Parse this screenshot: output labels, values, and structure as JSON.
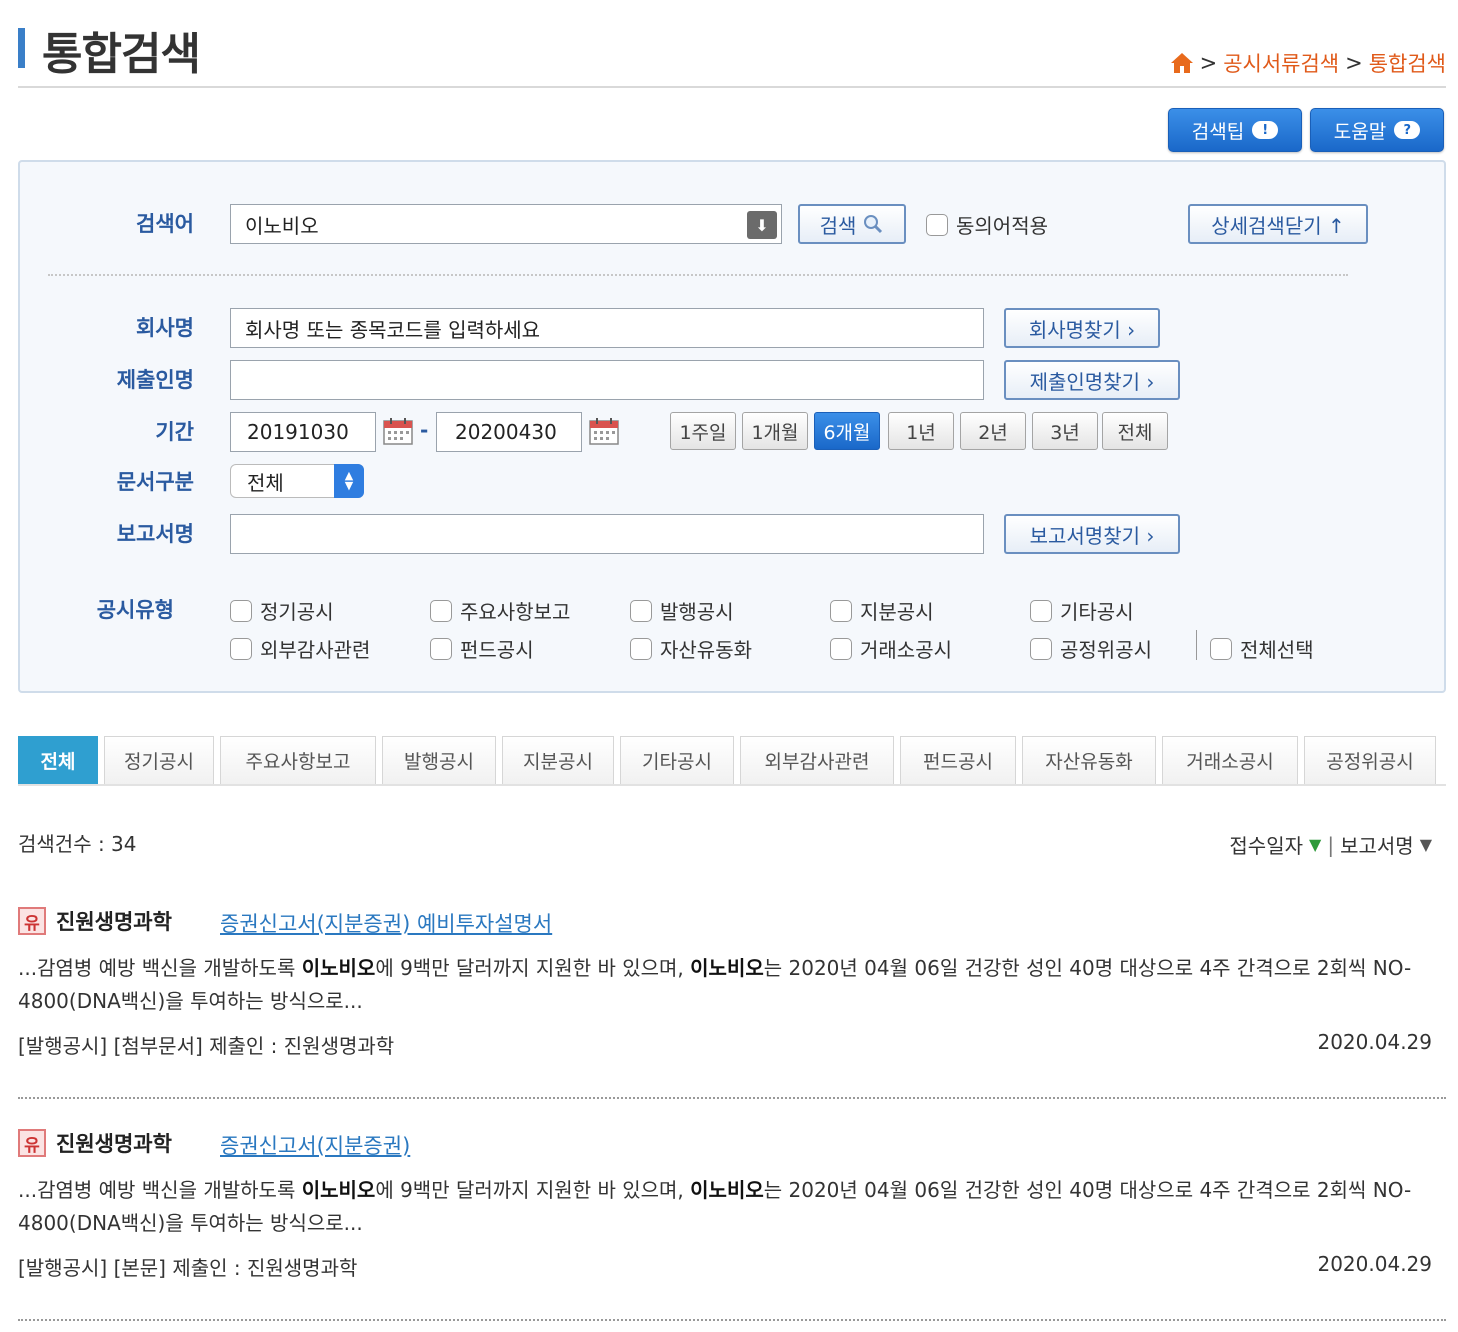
{
  "header": {
    "title": "통합검색",
    "breadcrumb": [
      "공시서류검색",
      "통합검색"
    ],
    "separator": ">"
  },
  "top_buttons": {
    "tips": "검색팁",
    "help": "도움말"
  },
  "search": {
    "keyword_label": "검색어",
    "keyword_value": "이노비오",
    "search_button": "검색",
    "synonym_label": "동의어적용",
    "detail_close_button": "상세검색닫기 ↑",
    "company_label": "회사명",
    "company_placeholder": "회사명 또는 종목코드를 입력하세요",
    "company_find_button": "회사명찾기 ›",
    "submitter_label": "제출인명",
    "submitter_value": "",
    "submitter_find_button": "제출인명찾기 ›",
    "period_label": "기간",
    "start_date": "20191030",
    "date_sep": "-",
    "end_date": "20200430",
    "period_buttons": [
      "1주일",
      "1개월",
      "6개월",
      "1년",
      "2년",
      "3년",
      "전체"
    ],
    "period_active": "6개월",
    "doc_type_label": "문서구분",
    "doc_type_value": "전체",
    "report_label": "보고서명",
    "report_value": "",
    "report_find_button": "보고서명찾기 ›",
    "disclosure_type_label": "공시유형",
    "disclosure_types_row1": [
      "정기공시",
      "주요사항보고",
      "발행공시",
      "지분공시",
      "기타공시"
    ],
    "disclosure_types_row2": [
      "외부감사관련",
      "펀드공시",
      "자산유동화",
      "거래소공시",
      "공정위공시"
    ],
    "select_all": "전체선택"
  },
  "tabs": [
    "전체",
    "정기공시",
    "주요사항보고",
    "발행공시",
    "지분공시",
    "기타공시",
    "외부감사관련",
    "펀드공시",
    "자산유동화",
    "거래소공시",
    "공정위공시"
  ],
  "results_summary": {
    "count_text": "검색건수 : 34",
    "sort_date": "접수일자",
    "sort_report": "보고서명"
  },
  "results": [
    {
      "badge": "유",
      "company": "진원생명과학",
      "report": "증권신고서(지분증권) 예비투자설명서",
      "snippet_pre": "...감염병 예방 백신을 개발하도록 ",
      "keyword": "이노비오",
      "snippet_mid": "에 9백만 달러까지 지원한 바 있으며, ",
      "snippet_post": "는 2020년 04월 06일 건강한 성인 40명 대상으로 4주 간격으로 2회씩 NO-4800(DNA백신)을 투여하는 방식으로...",
      "meta": "[발행공시] [첨부문서] 제출인 : 진원생명과학",
      "date": "2020.04.29"
    },
    {
      "badge": "유",
      "company": "진원생명과학",
      "report": "증권신고서(지분증권)",
      "snippet_pre": "...감염병 예방 백신을 개발하도록 ",
      "keyword": "이노비오",
      "snippet_mid": "에 9백만 달러까지 지원한 바 있으며, ",
      "snippet_post": "는 2020년 04월 06일 건강한 성인 40명 대상으로 4주 간격으로 2회씩 NO-4800(DNA백신)을 투여하는 방식으로...",
      "meta": "[발행공시] [본문] 제출인 : 진원생명과학",
      "date": "2020.04.29"
    }
  ]
}
